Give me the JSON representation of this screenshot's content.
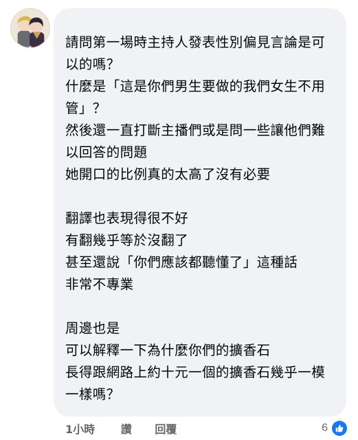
{
  "comment": {
    "lines": [
      "請問第一場時主持人發表性別偏見言論是可",
      "以的嗎？",
      "什麼是「這是你們男生要做的我們女生不用",
      "管」？",
      "然後還一直打斷主播們或是問一些讓他們難",
      "以回答的問題",
      "她開口的比例真的太高了沒有必要",
      "",
      "翻譯也表現得很不好",
      "有翻幾乎等於沒翻了",
      "甚至還說「你們應該都聽懂了」這種話",
      "非常不專業",
      "",
      "周邊也是",
      "可以解釋一下為什麼你們的擴香石",
      "長得跟網路上約十元一個的擴香石幾乎一模",
      "一樣嗎？"
    ]
  },
  "actions": {
    "timestamp": "1小時",
    "like_label": "讚",
    "reply_label": "回覆"
  },
  "reactions": {
    "count": "6",
    "icon": "thumbs-up-icon"
  },
  "colors": {
    "bubble": "#f0f2f5",
    "text": "#050505",
    "meta": "#65676b",
    "like_blue": "#1877f2"
  }
}
